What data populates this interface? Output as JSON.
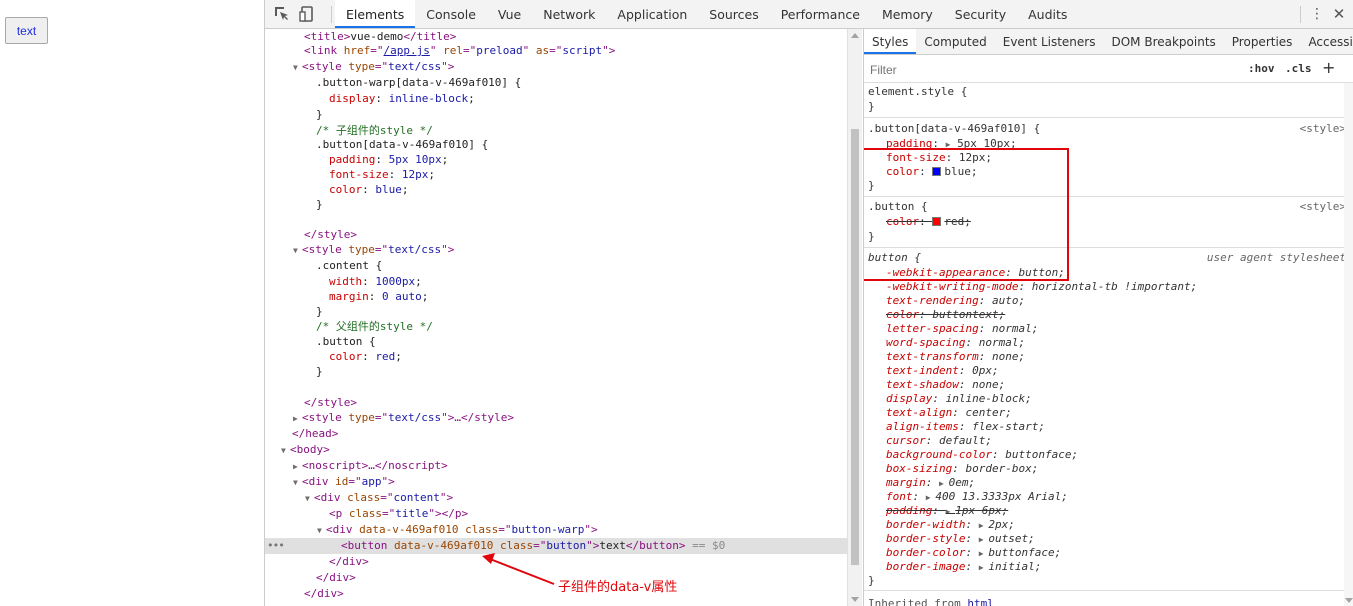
{
  "page": {
    "button_label": "text"
  },
  "devtools": {
    "tabs": [
      "Elements",
      "Console",
      "Vue",
      "Network",
      "Application",
      "Sources",
      "Performance",
      "Memory",
      "Security",
      "Audits"
    ],
    "active_tab": "Elements"
  },
  "elements_lines": {
    "l0": {
      "pre": "<",
      "tag1": "title",
      "mid": ">vue-demo</",
      "tag2": "title",
      "post": ">"
    },
    "l1": {
      "tag": "link",
      "attr1": "href",
      "val1": "/app.js",
      "attr2": "rel",
      "val2": "preload",
      "attr3": "as",
      "val3": "script"
    },
    "l2": {
      "tag": "style",
      "attr": "type",
      "val": "text/css"
    },
    "l3": ".button-warp[data-v-469af010] {",
    "l4p": "display",
    "l4v": "inline-block",
    "l5": "}",
    "l6": "/* 子组件的style */",
    "l7": ".button[data-v-469af010] {",
    "l8p": "padding",
    "l8v": "5px 10px",
    "l9p": "font-size",
    "l9v": "12px",
    "l10p": "color",
    "l10v": "blue",
    "l11": "}",
    "l13": "</style>",
    "l14": {
      "tag": "style",
      "attr": "type",
      "val": "text/css"
    },
    "l15": ".content {",
    "l16p": "width",
    "l16v": "1000px",
    "l17p": "margin",
    "l17v": "0 auto",
    "l18": "}",
    "l19": "/* 父组件的style */",
    "l20": ".button {",
    "l21p": "color",
    "l21v": "red",
    "l22": "}",
    "l24": "</style>",
    "l25": {
      "tag": "style",
      "attr": "type",
      "val": "text/css",
      "rest": "…</style>"
    },
    "l26": "</head>",
    "l27": "<body>",
    "l28": "<noscript>…</noscript>",
    "l29": {
      "tag": "div",
      "attr": "id",
      "val": "app"
    },
    "l30": {
      "tag": "div",
      "attr": "class",
      "val": "content"
    },
    "l31": {
      "tag": "p",
      "attr": "class",
      "val": "title",
      "close": "></p>"
    },
    "l32": {
      "tag": "div",
      "attr1": "data-v-469af010",
      "attr2": "class",
      "val2": "button-warp"
    },
    "l33": {
      "tag": "button",
      "attr1": "data-v-469af010",
      "attr2": "class",
      "val2": "button",
      "text": "text",
      "close": "</button>",
      "eq": " == $0"
    },
    "l34": "</div>",
    "l35": "</div>",
    "l36": "</div>"
  },
  "styles": {
    "subtabs": [
      "Styles",
      "Computed",
      "Event Listeners",
      "DOM Breakpoints",
      "Properties",
      "Accessibility"
    ],
    "filter_placeholder": "Filter",
    "hov": ":hov",
    "cls": ".cls",
    "element_style": "element.style {",
    "close_brace": "}",
    "rule1_selector": ".button[data-v-469af010] {",
    "rule1_origin": "<style>",
    "rule1_padding_name": "padding",
    "rule1_padding_val": "5px 10px",
    "rule1_fontsize_name": "font-size",
    "rule1_fontsize_val": "12px",
    "rule1_color_name": "color",
    "rule1_color_val": "blue",
    "rule2_selector": ".button {",
    "rule2_origin": "<style>",
    "rule2_color_name": "color",
    "rule2_color_val": "red",
    "ua_selector": "button {",
    "ua_origin": "user agent stylesheet",
    "ua_props": [
      {
        "n": "-webkit-appearance",
        "v": "button",
        "s": false
      },
      {
        "n": "-webkit-writing-mode",
        "v": "horizontal-tb !important",
        "s": false
      },
      {
        "n": "text-rendering",
        "v": "auto",
        "s": false
      },
      {
        "n": "color",
        "v": "buttontext",
        "s": true
      },
      {
        "n": "letter-spacing",
        "v": "normal",
        "s": false
      },
      {
        "n": "word-spacing",
        "v": "normal",
        "s": false
      },
      {
        "n": "text-transform",
        "v": "none",
        "s": false
      },
      {
        "n": "text-indent",
        "v": "0px",
        "s": false
      },
      {
        "n": "text-shadow",
        "v": "none",
        "s": false
      },
      {
        "n": "display",
        "v": "inline-block",
        "s": false
      },
      {
        "n": "text-align",
        "v": "center",
        "s": false
      },
      {
        "n": "align-items",
        "v": "flex-start",
        "s": false
      },
      {
        "n": "cursor",
        "v": "default",
        "s": false
      },
      {
        "n": "background-color",
        "v": "buttonface",
        "s": false
      },
      {
        "n": "box-sizing",
        "v": "border-box",
        "s": false
      },
      {
        "n": "margin",
        "v": "0em",
        "s": false,
        "exp": true
      },
      {
        "n": "font",
        "v": "400 13.3333px Arial",
        "s": false,
        "exp": true
      },
      {
        "n": "padding",
        "v": "1px 6px",
        "s": true,
        "exp": true
      },
      {
        "n": "border-width",
        "v": "2px",
        "s": false,
        "exp": true
      },
      {
        "n": "border-style",
        "v": "outset",
        "s": false,
        "exp": true
      },
      {
        "n": "border-color",
        "v": "buttonface",
        "s": false,
        "exp": true
      },
      {
        "n": "border-image",
        "v": "initial",
        "s": false,
        "exp": true
      }
    ],
    "inherited_label": "Inherited from",
    "inherited_tag": "html"
  },
  "colors": {
    "blue_swatch": "#0000ff",
    "red_swatch": "#ff0000",
    "annotation": "#e1060b",
    "active_tab": "#1a73e8"
  },
  "annotation": {
    "text": "子组件的data-v属性"
  }
}
